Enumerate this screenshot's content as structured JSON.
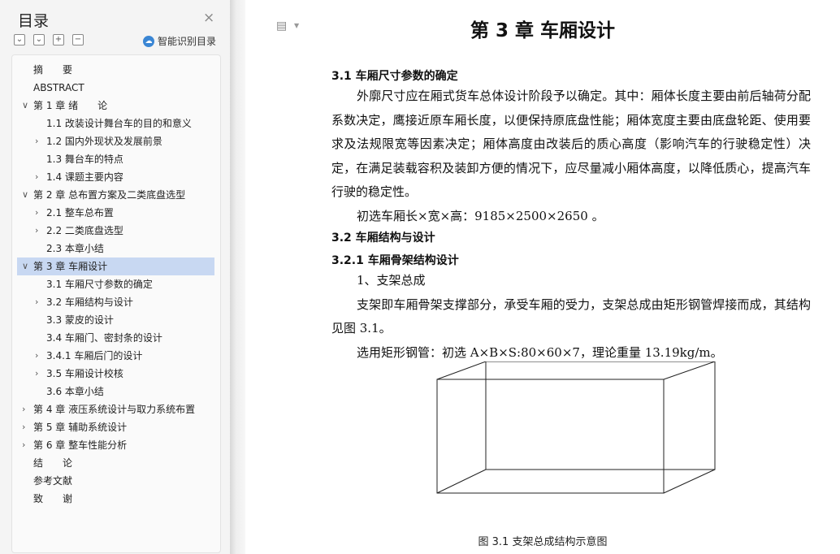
{
  "sidebar": {
    "title": "目录",
    "close_icon": "×",
    "tools": [
      "⌄",
      "⌄",
      "+",
      "−"
    ],
    "smart_label": "智能识别目录",
    "items": [
      {
        "label": "摘　　要",
        "chev": ""
      },
      {
        "label": "ABSTRACT",
        "chev": ""
      },
      {
        "label": "第 1 章 绪　　论",
        "chev": "∨"
      },
      {
        "label": "1.1 改装设计舞台车的目的和意义",
        "chev": ""
      },
      {
        "label": "1.2 国内外现状及发展前景",
        "chev": "›"
      },
      {
        "label": "1.3 舞台车的特点",
        "chev": ""
      },
      {
        "label": "1.4 课题主要内容",
        "chev": "›"
      },
      {
        "label": "第 2 章 总布置方案及二类底盘选型",
        "chev": "∨"
      },
      {
        "label": "2.1 整车总布置",
        "chev": "›"
      },
      {
        "label": "2.2 二类底盘选型",
        "chev": "›"
      },
      {
        "label": "2.3 本章小结",
        "chev": ""
      },
      {
        "label": "第 3 章 车厢设计",
        "chev": "∨"
      },
      {
        "label": "3.1 车厢尺寸参数的确定",
        "chev": ""
      },
      {
        "label": "3.2 车厢结构与设计",
        "chev": "›"
      },
      {
        "label": "3.3 蒙皮的设计",
        "chev": ""
      },
      {
        "label": "3.4 车厢门、密封条的设计",
        "chev": ""
      },
      {
        "label": "3.4.1 车厢后门的设计",
        "chev": "›"
      },
      {
        "label": "3.5 车厢设计校核",
        "chev": "›"
      },
      {
        "label": "3.6 本章小结",
        "chev": ""
      },
      {
        "label": "第 4 章 液压系统设计与取力系统布置",
        "chev": "›"
      },
      {
        "label": "第 5 章 辅助系统设计",
        "chev": "›"
      },
      {
        "label": "第 6 章 整车性能分析",
        "chev": "›"
      },
      {
        "label": "结　　论",
        "chev": ""
      },
      {
        "label": "参考文献",
        "chev": ""
      },
      {
        "label": "致　　谢",
        "chev": ""
      }
    ]
  },
  "document": {
    "chapter_title": "第 3 章  车厢设计",
    "s31_heading": "3.1  车厢尺寸参数的确定",
    "p1": "外廓尺寸应在厢式货车总体设计阶段予以确定。其中：厢体长度主要由前后轴荷分配系数决定，鹰接近原车厢长度，以便保持原底盘性能；厢体宽度主要由底盘轮距、使用要求及法规限宽等因素决定；厢体高度由改装后的质心高度（影响汽车的行驶稳定性）决定，在满足装载容积及装卸方便的情况下，应尽量减小厢体高度，以降低质心，提高汽车行驶的稳定性。",
    "p2": "初选车厢长×宽×高：9185×2500×2650  。",
    "s32_heading": "3.2  车厢结构与设计",
    "s321_heading": "3.2.1 车厢骨架结构设计",
    "p3": "1、支架总成",
    "p4": "支架即车厢骨架支撑部分，承受车厢的受力，支架总成由矩形钢管焊接而成，其结构见图 3.1。",
    "p5": "选用矩形钢管：初选 A×B×S:80×60×7，理论重量 13.19kg/m。",
    "figure_caption": "图 3.1  支架总成结构示意图"
  }
}
